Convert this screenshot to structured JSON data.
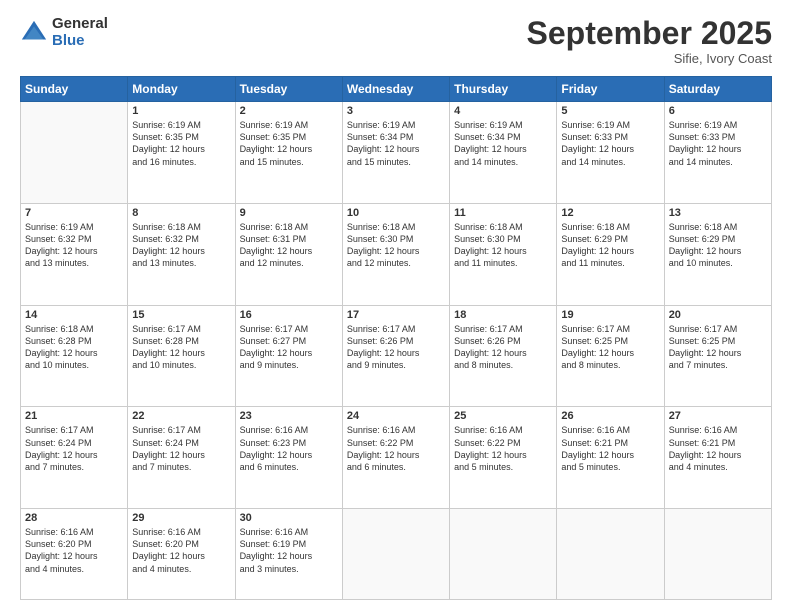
{
  "logo": {
    "general": "General",
    "blue": "Blue"
  },
  "header": {
    "month": "September 2025",
    "location": "Sifie, Ivory Coast"
  },
  "weekdays": [
    "Sunday",
    "Monday",
    "Tuesday",
    "Wednesday",
    "Thursday",
    "Friday",
    "Saturday"
  ],
  "weeks": [
    [
      {
        "day": "",
        "info": ""
      },
      {
        "day": "1",
        "info": "Sunrise: 6:19 AM\nSunset: 6:35 PM\nDaylight: 12 hours\nand 16 minutes."
      },
      {
        "day": "2",
        "info": "Sunrise: 6:19 AM\nSunset: 6:35 PM\nDaylight: 12 hours\nand 15 minutes."
      },
      {
        "day": "3",
        "info": "Sunrise: 6:19 AM\nSunset: 6:34 PM\nDaylight: 12 hours\nand 15 minutes."
      },
      {
        "day": "4",
        "info": "Sunrise: 6:19 AM\nSunset: 6:34 PM\nDaylight: 12 hours\nand 14 minutes."
      },
      {
        "day": "5",
        "info": "Sunrise: 6:19 AM\nSunset: 6:33 PM\nDaylight: 12 hours\nand 14 minutes."
      },
      {
        "day": "6",
        "info": "Sunrise: 6:19 AM\nSunset: 6:33 PM\nDaylight: 12 hours\nand 14 minutes."
      }
    ],
    [
      {
        "day": "7",
        "info": "Sunrise: 6:19 AM\nSunset: 6:32 PM\nDaylight: 12 hours\nand 13 minutes."
      },
      {
        "day": "8",
        "info": "Sunrise: 6:18 AM\nSunset: 6:32 PM\nDaylight: 12 hours\nand 13 minutes."
      },
      {
        "day": "9",
        "info": "Sunrise: 6:18 AM\nSunset: 6:31 PM\nDaylight: 12 hours\nand 12 minutes."
      },
      {
        "day": "10",
        "info": "Sunrise: 6:18 AM\nSunset: 6:30 PM\nDaylight: 12 hours\nand 12 minutes."
      },
      {
        "day": "11",
        "info": "Sunrise: 6:18 AM\nSunset: 6:30 PM\nDaylight: 12 hours\nand 11 minutes."
      },
      {
        "day": "12",
        "info": "Sunrise: 6:18 AM\nSunset: 6:29 PM\nDaylight: 12 hours\nand 11 minutes."
      },
      {
        "day": "13",
        "info": "Sunrise: 6:18 AM\nSunset: 6:29 PM\nDaylight: 12 hours\nand 10 minutes."
      }
    ],
    [
      {
        "day": "14",
        "info": "Sunrise: 6:18 AM\nSunset: 6:28 PM\nDaylight: 12 hours\nand 10 minutes."
      },
      {
        "day": "15",
        "info": "Sunrise: 6:17 AM\nSunset: 6:28 PM\nDaylight: 12 hours\nand 10 minutes."
      },
      {
        "day": "16",
        "info": "Sunrise: 6:17 AM\nSunset: 6:27 PM\nDaylight: 12 hours\nand 9 minutes."
      },
      {
        "day": "17",
        "info": "Sunrise: 6:17 AM\nSunset: 6:26 PM\nDaylight: 12 hours\nand 9 minutes."
      },
      {
        "day": "18",
        "info": "Sunrise: 6:17 AM\nSunset: 6:26 PM\nDaylight: 12 hours\nand 8 minutes."
      },
      {
        "day": "19",
        "info": "Sunrise: 6:17 AM\nSunset: 6:25 PM\nDaylight: 12 hours\nand 8 minutes."
      },
      {
        "day": "20",
        "info": "Sunrise: 6:17 AM\nSunset: 6:25 PM\nDaylight: 12 hours\nand 7 minutes."
      }
    ],
    [
      {
        "day": "21",
        "info": "Sunrise: 6:17 AM\nSunset: 6:24 PM\nDaylight: 12 hours\nand 7 minutes."
      },
      {
        "day": "22",
        "info": "Sunrise: 6:17 AM\nSunset: 6:24 PM\nDaylight: 12 hours\nand 7 minutes."
      },
      {
        "day": "23",
        "info": "Sunrise: 6:16 AM\nSunset: 6:23 PM\nDaylight: 12 hours\nand 6 minutes."
      },
      {
        "day": "24",
        "info": "Sunrise: 6:16 AM\nSunset: 6:22 PM\nDaylight: 12 hours\nand 6 minutes."
      },
      {
        "day": "25",
        "info": "Sunrise: 6:16 AM\nSunset: 6:22 PM\nDaylight: 12 hours\nand 5 minutes."
      },
      {
        "day": "26",
        "info": "Sunrise: 6:16 AM\nSunset: 6:21 PM\nDaylight: 12 hours\nand 5 minutes."
      },
      {
        "day": "27",
        "info": "Sunrise: 6:16 AM\nSunset: 6:21 PM\nDaylight: 12 hours\nand 4 minutes."
      }
    ],
    [
      {
        "day": "28",
        "info": "Sunrise: 6:16 AM\nSunset: 6:20 PM\nDaylight: 12 hours\nand 4 minutes."
      },
      {
        "day": "29",
        "info": "Sunrise: 6:16 AM\nSunset: 6:20 PM\nDaylight: 12 hours\nand 4 minutes."
      },
      {
        "day": "30",
        "info": "Sunrise: 6:16 AM\nSunset: 6:19 PM\nDaylight: 12 hours\nand 3 minutes."
      },
      {
        "day": "",
        "info": ""
      },
      {
        "day": "",
        "info": ""
      },
      {
        "day": "",
        "info": ""
      },
      {
        "day": "",
        "info": ""
      }
    ]
  ]
}
